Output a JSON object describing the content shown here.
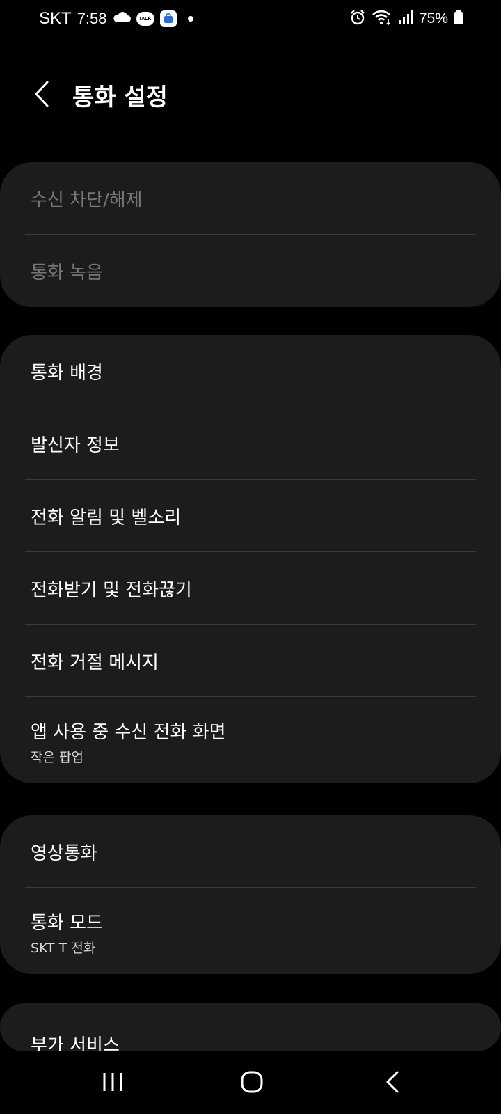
{
  "status_bar": {
    "carrier": "SKT",
    "time": "7:58",
    "talk_badge": "TALK",
    "battery": "75%"
  },
  "header": {
    "title": "통화 설정"
  },
  "groups": [
    {
      "items": [
        {
          "label": "수신 차단/해제",
          "enabled": false
        },
        {
          "label": "통화 녹음",
          "enabled": false
        }
      ]
    },
    {
      "items": [
        {
          "label": "통화 배경"
        },
        {
          "label": "발신자 정보"
        },
        {
          "label": "전화 알림 및 벨소리"
        },
        {
          "label": "전화받기 및 전화끊기"
        },
        {
          "label": "전화 거절 메시지"
        },
        {
          "label": "앱 사용 중 수신 전화 화면",
          "sublabel": "작은 팝업"
        }
      ]
    },
    {
      "items": [
        {
          "label": "영상통화"
        },
        {
          "label": "통화 모드",
          "sublabel": "SKT T 전화"
        }
      ]
    },
    {
      "items": [
        {
          "label": "부가 서비스"
        }
      ]
    }
  ],
  "colors": {
    "background": "#000000",
    "card": "#1c1c1e",
    "divider": "#3a3a3c",
    "disabled_text": "#77777a"
  }
}
